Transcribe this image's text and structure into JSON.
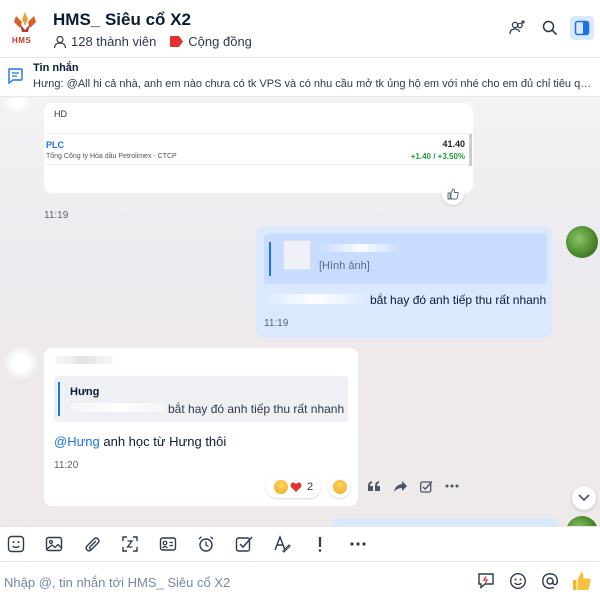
{
  "header": {
    "group_name": "HMS_ Siêu cổ X2",
    "logo_text": "HMS",
    "members": "128 thành viên",
    "community": "Cộng đồng",
    "icons": [
      "add-member-icon",
      "search-icon",
      "sidebar-toggle-icon"
    ],
    "accent": "#1a73e8"
  },
  "pinned": {
    "title": "Tin nhắn",
    "text": "Hưng: @All hi cả nhà, anh em nào chưa có tk VPS và có nhu cầu mở tk ủng hộ em với nhé cho em đủ chỉ tiêu quý này với..."
  },
  "messages": {
    "card1": {
      "label": "HD",
      "stock": {
        "symbol": "PLC",
        "company": "Tổng Công ty Hóa dầu Petrolimex - CTCP",
        "price": "41.40",
        "change": "+1.40 / +3.50%",
        "change_color": "#1f9b3a"
      },
      "time": "11:19"
    },
    "card2": {
      "reply_image_label": "[Hình ảnh]",
      "text": "bắt hay đó anh tiếp thu rất nhanh",
      "time": "11:19"
    },
    "card3": {
      "reply_name": "Hưng",
      "reply_text": "bắt hay đó anh tiếp thu rất nhanh",
      "mention": "@Hưng",
      "text": " anh học từ Hưng thôi",
      "time": "11:20",
      "reaction_count": "2"
    }
  },
  "input": {
    "placeholder": "Nhập @, tin nhắn tới HMS_ Siêu cổ X2"
  }
}
